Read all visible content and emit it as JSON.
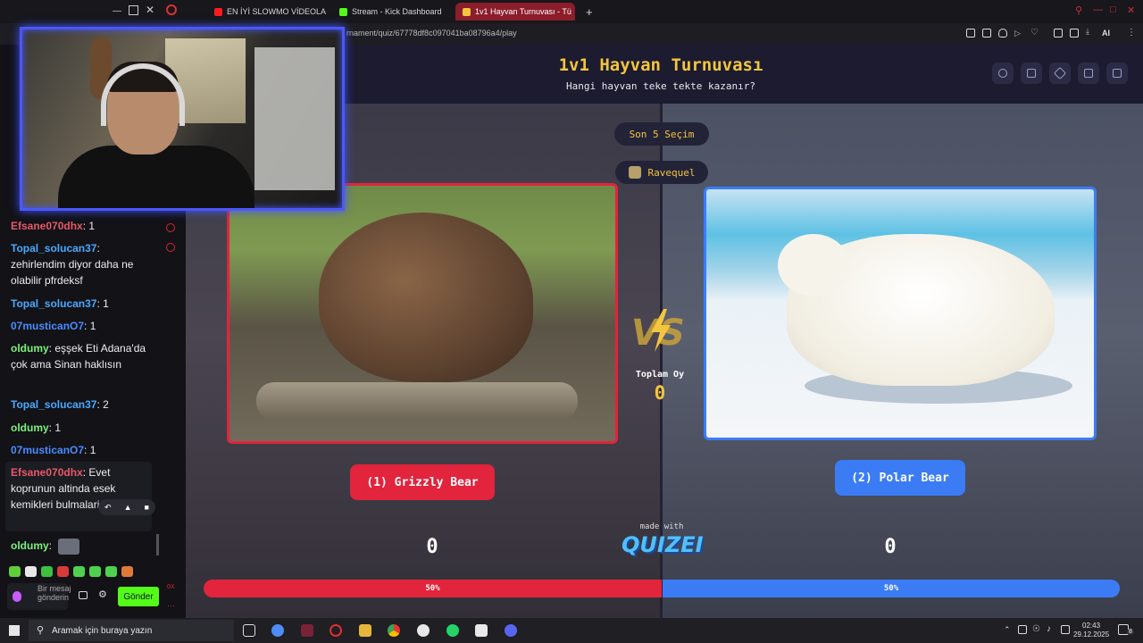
{
  "browser": {
    "tabs": [
      {
        "label": "EN İYİ SLOWMO VİDEOLA",
        "color": "#ff1c1c"
      },
      {
        "label": "Stream - Kick Dashboard",
        "color": "#53fc18"
      },
      {
        "label": "1v1 Hayvan Turnuvası - Tü",
        "color": "#f3c53e"
      }
    ],
    "new_tab_label": "+",
    "url": "rnament/quiz/67778df8c097041ba08796a4/play",
    "ai_label": "AI"
  },
  "chat": {
    "messages": [
      {
        "user": "Efsane070dhx",
        "user_color": "#e8586a",
        "text": ": 1"
      },
      {
        "user": "Topal_solucan37",
        "user_color": "#4aa8ff",
        "text": ": zehirlendim diyor daha ne olabilir pfrdeksf"
      },
      {
        "user": "Topal_solucan37",
        "user_color": "#4aa8ff",
        "text": ": 1"
      },
      {
        "user": "07musticanO7",
        "user_color": "#4a8cff",
        "text": ": 1"
      },
      {
        "user": "oldumy",
        "user_color": "#7cf07c",
        "text": ": eşşek Eti Adana'da çok ama Sinan haklısın"
      },
      {
        "user": "Topal_solucan37",
        "user_color": "#4aa8ff",
        "text": ": 2"
      },
      {
        "user": "oldumy",
        "user_color": "#7cf07c",
        "text": ": 1"
      },
      {
        "user": "07musticanO7",
        "user_color": "#4a8cff",
        "text": ": 1"
      },
      {
        "user": "Efsane070dhx",
        "user_color": "#e8586a",
        "text": ": Evet koprunun altinda esek kemikleri bulmalari saka mi"
      },
      {
        "user": "oldumy",
        "user_color": "#7cf07c",
        "text": ":"
      }
    ],
    "input_placeholder": "Bir mesaj gönderin",
    "send_label": "Gönder",
    "char_count": "0X"
  },
  "quiz": {
    "title": "1v1 Hayvan Turnuvası",
    "subtitle": "Hangi hayvan teke tekte kazanır?",
    "last_choices_label": "Son 5 Seçim",
    "user_label": "Ravequel",
    "total_votes_label": "Toplam Oy",
    "total_votes": "0",
    "left": {
      "label": "(1) Grizzly Bear",
      "votes": "0",
      "percent_label": "50%",
      "percent": 50
    },
    "right": {
      "label": "(2) Polar Bear",
      "votes": "0",
      "percent_label": "50%",
      "percent": 50
    },
    "made_with": "made with",
    "logo": "QUIZEI"
  },
  "taskbar": {
    "search_placeholder": "Aramak için buraya yazın",
    "time": "02:43",
    "date": "29.12.2025",
    "notification_count": "8"
  },
  "colors": {
    "accent_red": "#e2243c",
    "accent_blue": "#3b7cf5",
    "accent_yellow": "#f3c53e",
    "kick_green": "#53fc18"
  }
}
